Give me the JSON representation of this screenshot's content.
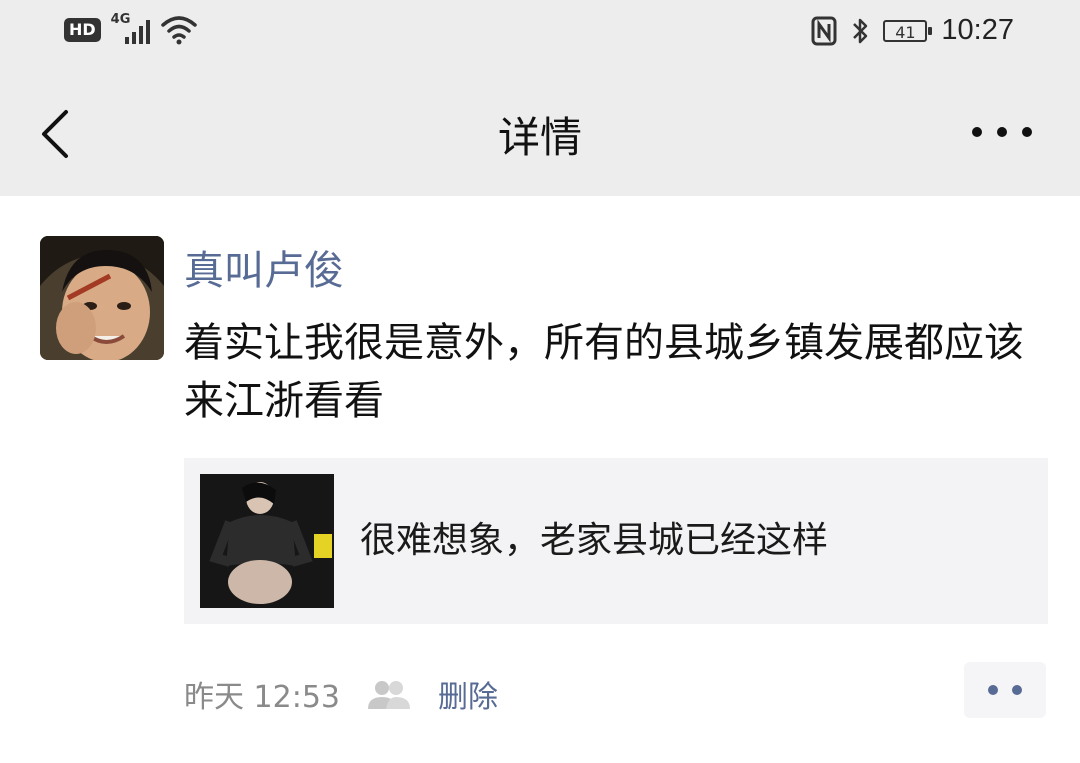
{
  "status_bar": {
    "hd_label": "HD",
    "network_label": "4G",
    "battery_level": "41",
    "time": "10:27",
    "icons": [
      "hd-icon",
      "signal-icon",
      "wifi-icon",
      "nfc-icon",
      "bluetooth-icon",
      "battery-icon"
    ]
  },
  "nav": {
    "title": "详情",
    "back_icon": "chevron-left-icon",
    "more_icon": "more-icon"
  },
  "post": {
    "username": "真叫卢俊",
    "text": "着实让我很是意外，所有的县城乡镇发展都应该来江浙看看",
    "shared": {
      "title": "很难想象，老家县城已经这样"
    },
    "time": "昨天 12:53",
    "delete_label": "删除"
  },
  "colors": {
    "bar_bg": "#ededed",
    "link_blue": "#576b95",
    "card_bg": "#f3f3f5"
  }
}
